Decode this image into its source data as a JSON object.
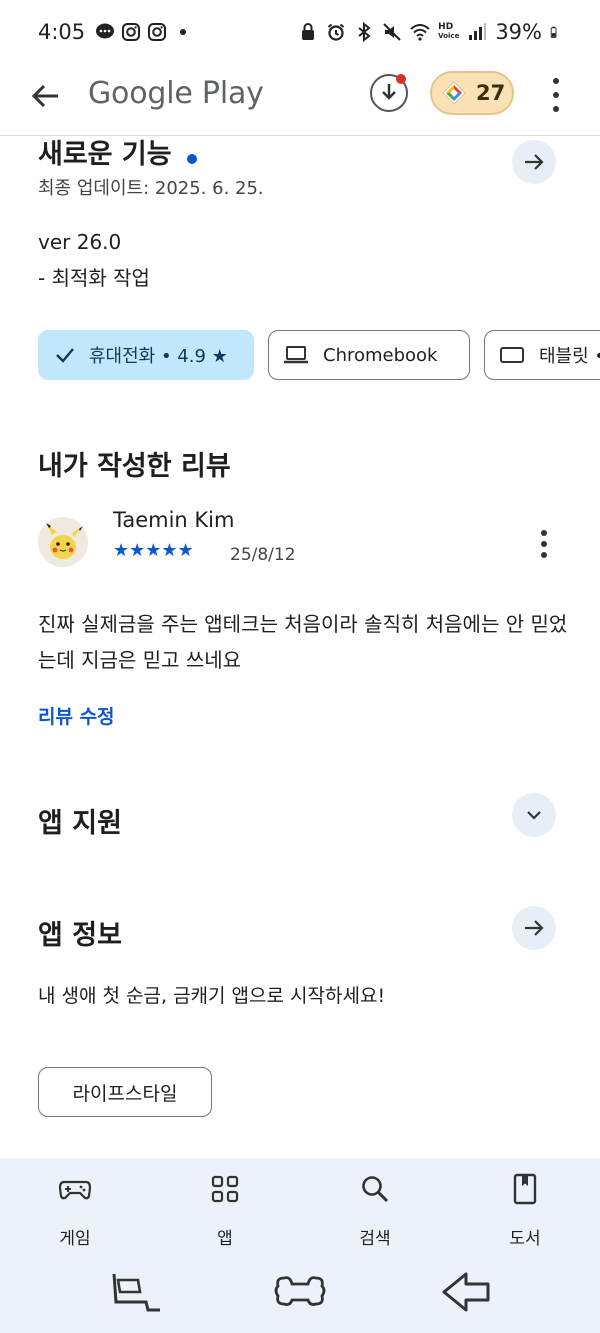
{
  "status_bar": {
    "time": "4:05",
    "battery": "39%",
    "hd_line1": "HD",
    "hd_line2": "Voice",
    "icons": [
      "chat-icon",
      "instagram-icon",
      "instagram-icon",
      "dot-icon",
      "lock-icon",
      "alarm-icon",
      "bluetooth-icon",
      "mute-icon",
      "wifi-icon",
      "hd-voice-icon",
      "signal-icon",
      "battery-icon"
    ]
  },
  "app_bar": {
    "title": "Google Play",
    "points": "27"
  },
  "whats_new": {
    "title": "새로운 기능",
    "updated": "최종 업데이트: 2025. 6. 25.",
    "version": "ver 26.0",
    "note": "- 최적화 작업"
  },
  "device_chips": [
    {
      "label": "휴대전화 • 4.9 ★",
      "selected": true
    },
    {
      "label": "Chromebook",
      "selected": false
    },
    {
      "label": "태블릿 •",
      "selected": false
    }
  ],
  "my_review": {
    "section_title": "내가 작성한 리뷰",
    "author": "Taemin Kim",
    "stars": "★★★★★",
    "rating": 5,
    "date": "25/8/12",
    "text": "진짜 실제금을 주는 앱테크는 처음이라 솔직히 처음에는 안 믿었는데 지금은 믿고 쓰네요",
    "edit_link": "리뷰 수정"
  },
  "app_support": {
    "title": "앱 지원"
  },
  "app_info": {
    "title": "앱 정보",
    "description": "내 생애 첫 순금, 금캐기 앱으로 시작하세요!",
    "category_tag": "라이프스타일"
  },
  "bottom_nav": [
    {
      "label": "게임",
      "icon": "gamepad-icon"
    },
    {
      "label": "앱",
      "icon": "apps-grid-icon"
    },
    {
      "label": "검색",
      "icon": "search-icon"
    },
    {
      "label": "도서",
      "icon": "book-icon"
    }
  ],
  "colors": {
    "accent": "#0b57d0",
    "chip_selected": "#c3e7fa",
    "round_button": "#e8eef7",
    "bottom_nav_bg": "#edf2fa",
    "points_chip": "#fbe2b6",
    "notification_dot": "#d93025"
  }
}
